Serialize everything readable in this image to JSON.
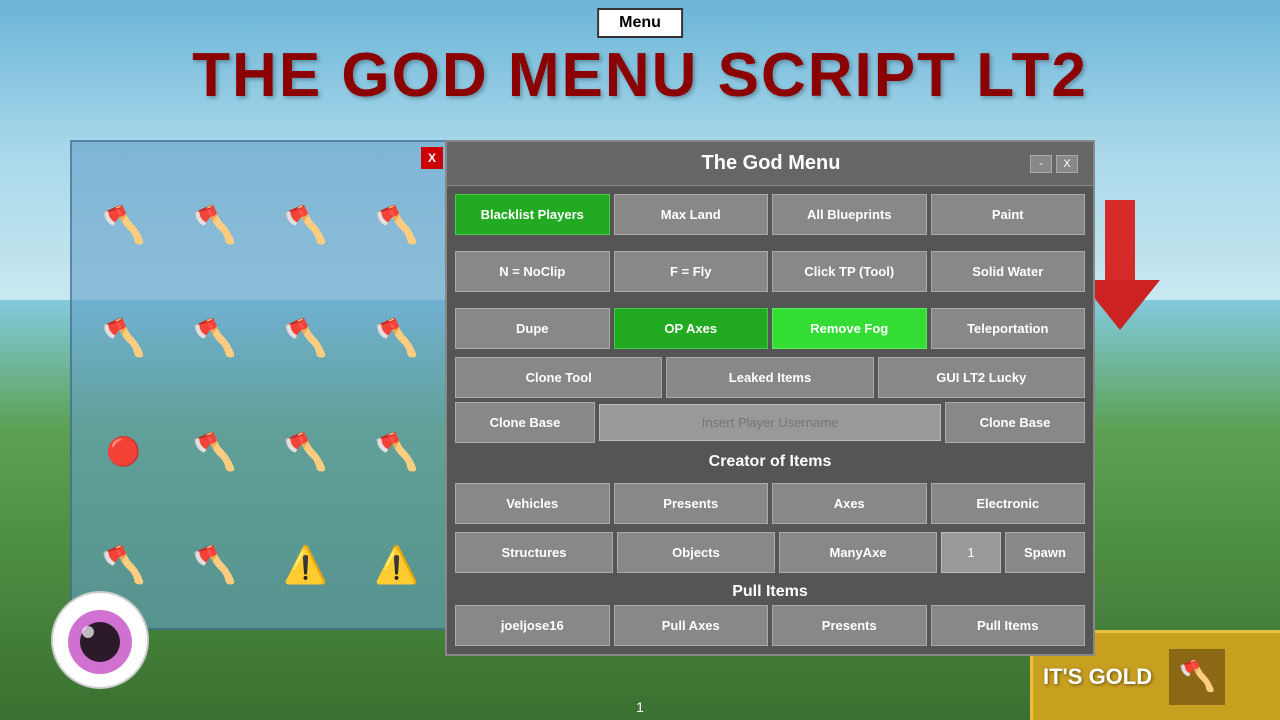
{
  "background": {
    "sky_color": "#87CEEB",
    "ground_color": "#4a8a40"
  },
  "menu_top": {
    "label": "Menu"
  },
  "title": "THE GOD MENU SCRIPT LT2",
  "left_panel": {
    "close_label": "X"
  },
  "dialog": {
    "title": "The God Menu",
    "min_label": "-",
    "close_label": "X",
    "row1": [
      {
        "label": "Blacklist Players",
        "style": "green"
      },
      {
        "label": "Max Land",
        "style": "normal"
      },
      {
        "label": "All Blueprints",
        "style": "normal"
      },
      {
        "label": "Paint",
        "style": "normal"
      }
    ],
    "row2": [
      {
        "label": "N = NoClip",
        "style": "normal"
      },
      {
        "label": "F = Fly",
        "style": "normal"
      },
      {
        "label": "Click TP (Tool)",
        "style": "normal"
      },
      {
        "label": "Solid Water",
        "style": "normal"
      }
    ],
    "row3": [
      {
        "label": "Dupe",
        "style": "normal"
      },
      {
        "label": "OP Axes",
        "style": "green"
      },
      {
        "label": "Remove Fog",
        "style": "bright-green"
      },
      {
        "label": "Teleportation",
        "style": "normal"
      }
    ],
    "row4": [
      {
        "label": "Clone Tool",
        "style": "normal"
      },
      {
        "label": "Leaked Items",
        "style": "normal"
      },
      {
        "label": "GUI LT2 Lucky",
        "style": "normal"
      }
    ],
    "clone_base": {
      "btn1_label": "Clone Base",
      "input_placeholder": "Insert Player Username",
      "btn2_label": "Clone Base"
    },
    "creator_section": "Creator of Items",
    "creator_row1": [
      {
        "label": "Vehicles"
      },
      {
        "label": "Presents"
      },
      {
        "label": "Axes"
      },
      {
        "label": "Electronic"
      }
    ],
    "spawn_row": [
      {
        "label": "Structures"
      },
      {
        "label": "Objects"
      },
      {
        "label": "ManyAxe"
      },
      {
        "label": "1"
      },
      {
        "label": "Spawn"
      }
    ],
    "pull_section": "Pull Items",
    "pull_row": [
      {
        "label": "joeljose16"
      },
      {
        "label": "Pull Axes"
      },
      {
        "label": "Presents"
      },
      {
        "label": "Pull Items"
      }
    ]
  },
  "gold_corner": {
    "text": "IT'S GOLD"
  },
  "page_num": "1"
}
